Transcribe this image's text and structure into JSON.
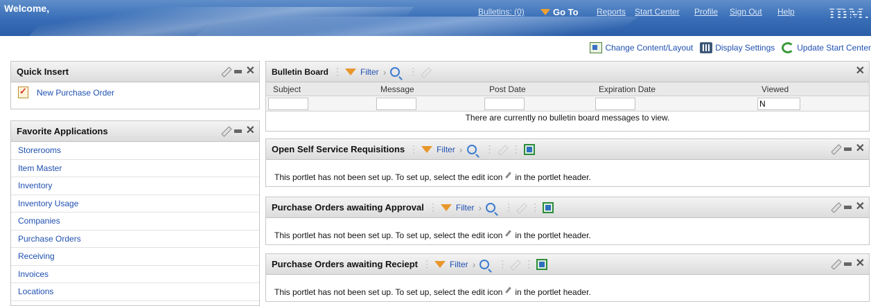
{
  "header": {
    "welcome": "Welcome,",
    "nav": {
      "bulletins": "Bulletins: (0)",
      "goto": "Go To",
      "reports": "Reports",
      "start_center": "Start Center",
      "profile": "Profile",
      "sign_out": "Sign Out",
      "help": "Help"
    },
    "logo": "IBM."
  },
  "layout_toolbar": {
    "change_content": "Change Content/Layout",
    "display_settings": "Display Settings",
    "update_start_center": "Update Start Center"
  },
  "quick_insert": {
    "title": "Quick Insert",
    "items": [
      {
        "label": "New Purchase Order",
        "icon": "clipboard-check-icon"
      }
    ]
  },
  "favorites": {
    "title": "Favorite Applications",
    "items": [
      "Storerooms",
      "Item Master",
      "Inventory",
      "Inventory Usage",
      "Companies",
      "Purchase Orders",
      "Receiving",
      "Invoices",
      "Locations"
    ]
  },
  "bulletin_board": {
    "title": "Bulletin Board",
    "filter_label": "Filter",
    "columns": [
      "Subject",
      "Message",
      "Post Date",
      "Expiration Date",
      "Viewed"
    ],
    "filter_values": {
      "viewed": "N"
    },
    "empty_message": "There are currently no bulletin board messages to view."
  },
  "portlets": [
    {
      "title": "Open Self Service Requisitions",
      "filter_label": "Filter",
      "message_before": "This portlet has not been set up. To set up, select the edit icon",
      "message_after": "in the portlet header."
    },
    {
      "title": "Purchase Orders awaiting Approval",
      "filter_label": "Filter",
      "message_before": "This portlet has not been set up. To set up, select the edit icon",
      "message_after": "in the portlet header."
    },
    {
      "title": "Purchase Orders awaiting Reciept",
      "filter_label": "Filter",
      "message_before": "This portlet has not been set up. To set up, select the edit icon",
      "message_after": "in the portlet header."
    }
  ],
  "colors": {
    "link": "#1f4fb0",
    "banner": "#3a6fb8",
    "filter_accent": "#e8962b"
  }
}
